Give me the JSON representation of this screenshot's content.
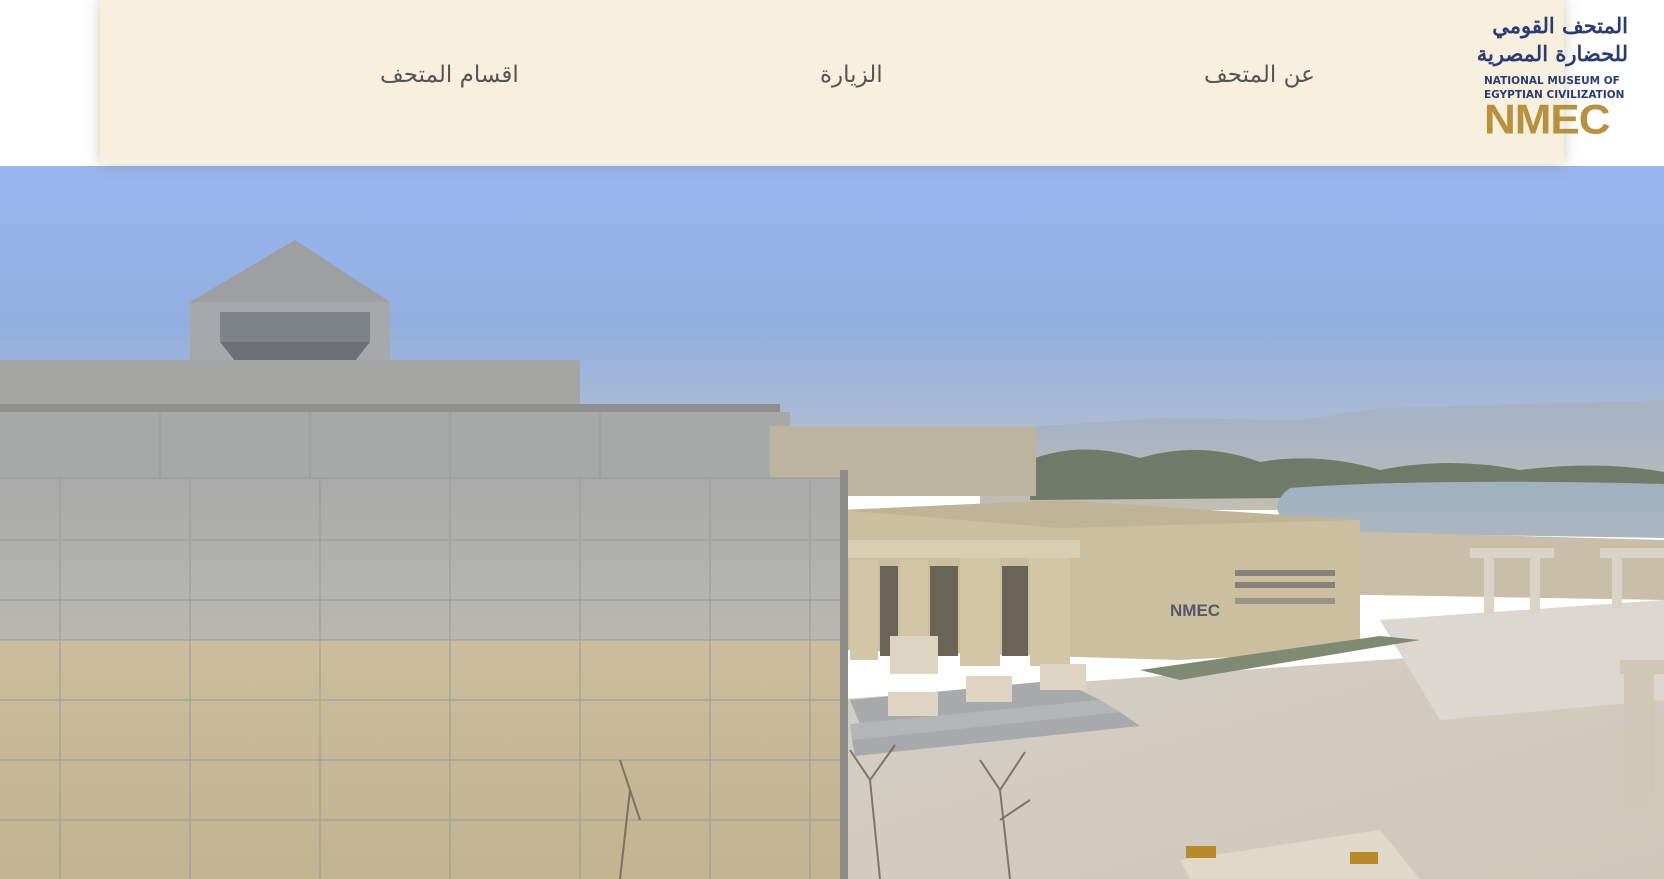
{
  "header": {
    "logo": {
      "arabic_line1": "المتحف القومي",
      "arabic_line2": "للحضارة المصرية",
      "english_line1": "NATIONAL MUSEUM OF",
      "english_line2": "EGYPTIAN CIVILIZATION",
      "acronym": "NMEC",
      "colors": {
        "navy": "#2a3d73",
        "gold": "#b8913e"
      }
    },
    "nav": {
      "about": "عن المتحف",
      "visit": "الزيارة",
      "sections": "اقسام المتحف"
    },
    "background_color": "#f8f0df"
  },
  "hero": {
    "image": "aerial-museum-building",
    "building_signage": "NMEC"
  }
}
